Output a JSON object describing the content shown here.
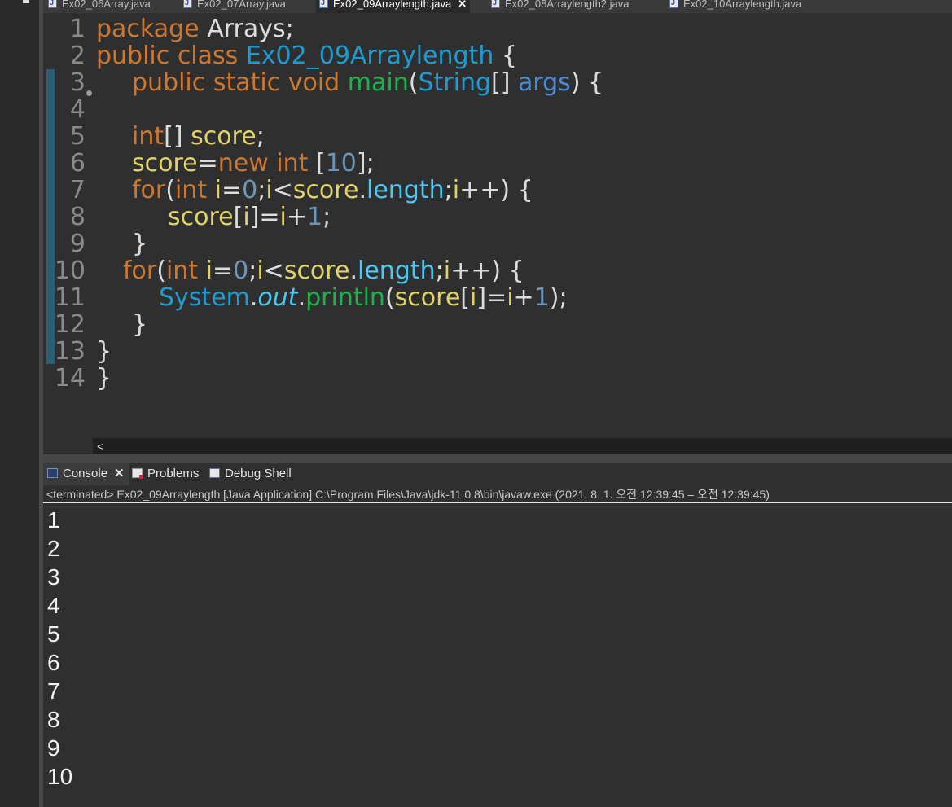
{
  "editor_tabs": [
    {
      "label": "Ex02_06Array.java",
      "active": false
    },
    {
      "label": "Ex02_07Array.java",
      "active": false
    },
    {
      "label": "Ex02_09Arraylength.java",
      "active": true
    },
    {
      "label": "Ex02_08Arraylength2.java",
      "active": false
    },
    {
      "label": "Ex02_10Arraylength.java",
      "active": false
    }
  ],
  "close_glyph": "✕",
  "line_numbers": [
    "1",
    "2",
    "3",
    "4",
    "5",
    "6",
    "7",
    "8",
    "9",
    "10",
    "11",
    "12",
    "13",
    "14"
  ],
  "code": {
    "l1": [
      "package",
      " Arrays;"
    ],
    "l2": [
      "public",
      " ",
      "class",
      " ",
      "Ex02_09Arraylength",
      " {"
    ],
    "l3": [
      "public",
      " ",
      "static",
      " ",
      "void",
      " ",
      "main",
      "(",
      "String",
      "[] ",
      "args",
      ") {"
    ],
    "l5": [
      "int",
      "[] ",
      "score",
      ";"
    ],
    "l6": [
      "score",
      "=",
      "new",
      " ",
      "int",
      " [",
      "10",
      "];"
    ],
    "l7": [
      "for",
      "(",
      "int",
      " ",
      "i",
      "=",
      "0",
      ";",
      "i",
      "<",
      "score",
      ".",
      "length",
      ";",
      "i",
      "++) {"
    ],
    "l8": [
      "score",
      "[",
      "i",
      "]=",
      "i",
      "+",
      "1",
      ";"
    ],
    "l9": [
      "}"
    ],
    "l10": [
      "for",
      "(",
      "int",
      " ",
      "i",
      "=",
      "0",
      ";",
      "i",
      "<",
      "score",
      ".",
      "length",
      ";",
      "i",
      "++) {"
    ],
    "l11": [
      "System",
      ".",
      "out",
      ".",
      "println",
      "(",
      "score",
      "[",
      "i",
      "]=",
      "i",
      "+",
      "1",
      ");"
    ],
    "l12": [
      "}"
    ],
    "l13": [
      "}"
    ],
    "l14": [
      "}"
    ]
  },
  "hscroll_arrow": "<",
  "view_tabs": [
    {
      "label": "Console",
      "active": true
    },
    {
      "label": "Problems",
      "active": false
    },
    {
      "label": "Debug Shell",
      "active": false
    }
  ],
  "console_status": "<terminated> Ex02_09Arraylength [Java Application] C:\\Program Files\\Java\\jdk-11.0.8\\bin\\javaw.exe  (2021. 8. 1. 오전 12:39:45 – 오전 12:39:45)",
  "console_output": [
    "1",
    "2",
    "3",
    "4",
    "5",
    "6",
    "7",
    "8",
    "9",
    "10"
  ],
  "colors": {
    "keyword": "#cc7832",
    "class_name": "#1f9bd0",
    "method": "#1bb44a",
    "type": "#4c8dd6",
    "variable": "#e0d36a",
    "field": "#4ec8f0",
    "number": "#6897bb",
    "background": "#2f2f2f"
  }
}
